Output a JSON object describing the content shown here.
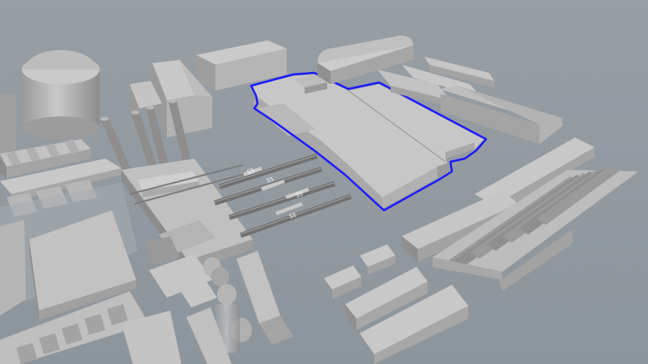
{
  "scene": {
    "selection_color": "#1a1aff",
    "ground_color": "#8d959c",
    "building_top_color": "#c4c4c4",
    "building_side_color": "#a9a9a9",
    "building_shadow_color": "#8a8a8a"
  },
  "conveyor_labels": [
    {
      "text": "S5"
    },
    {
      "text": "S5"
    },
    {
      "text": "S5"
    },
    {
      "text": "S5"
    }
  ]
}
